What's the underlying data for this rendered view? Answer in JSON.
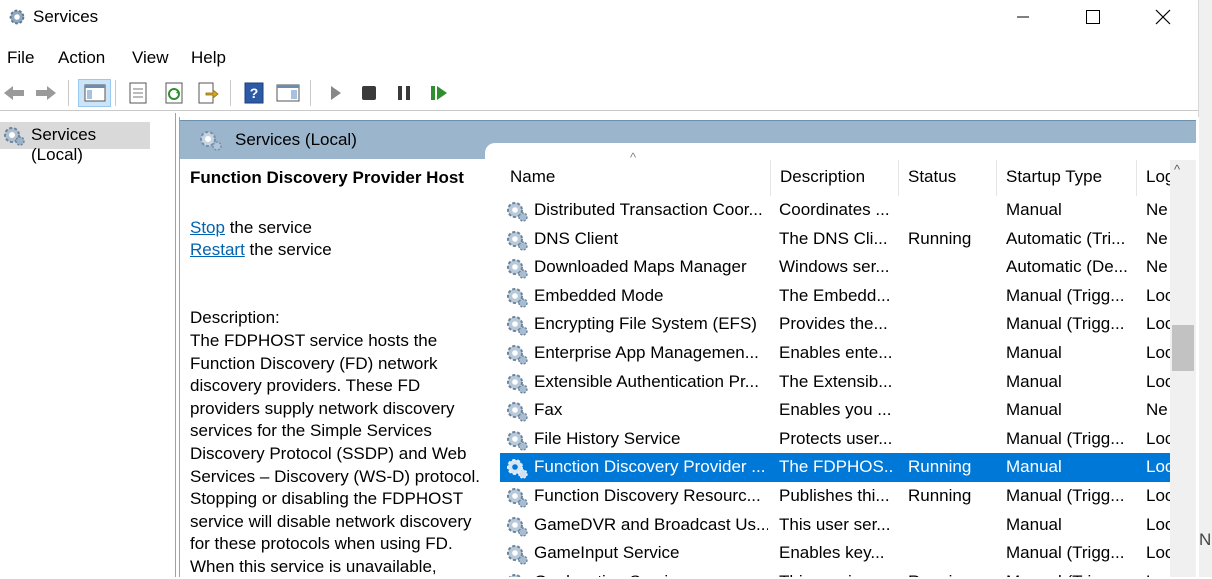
{
  "window": {
    "title": "Services",
    "app_icon": "services-gear-icon",
    "buttons": {
      "minimize": "─",
      "maximize": "☐",
      "close": "✕"
    }
  },
  "menu": [
    "File",
    "Action",
    "View",
    "Help"
  ],
  "toolbar": [
    "back-arrow-icon",
    "forward-arrow-icon",
    "show-hide-console-tree-icon",
    "properties-icon",
    "refresh-icon",
    "export-list-icon",
    "help-icon",
    "show-hide-action-pane-icon",
    "start-service-icon",
    "stop-service-icon",
    "pause-service-icon",
    "resume-service-icon"
  ],
  "tree": {
    "label": "Services (Local)"
  },
  "panel": {
    "title": "Services (Local)"
  },
  "description_pane": {
    "service_name": "Function Discovery Provider Host",
    "stop_link": "Stop",
    "stop_suffix": " the service",
    "restart_link": "Restart",
    "restart_suffix": " the service",
    "description_label": "Description:",
    "description_lines": [
      "The FDPHOST service hosts the",
      "Function Discovery (FD) network",
      "discovery providers. These FD",
      "providers supply network discovery",
      "services for the Simple Services",
      "Discovery Protocol (SSDP) and Web",
      "Services – Discovery (WS-D) protocol.",
      "Stopping or disabling the FDPHOST",
      "service will disable network discovery",
      "for these protocols when using FD.",
      "When this service is unavailable,"
    ]
  },
  "list": {
    "columns": [
      "Name",
      "Description",
      "Status",
      "Startup Type",
      "Log"
    ],
    "sort_indicator": "^",
    "rows": [
      {
        "name": "Distributed Transaction Coor...",
        "description": "Coordinates ...",
        "status": "",
        "startup": "Manual",
        "logon": "Ne"
      },
      {
        "name": "DNS Client",
        "description": "The DNS Cli...",
        "status": "Running",
        "startup": "Automatic (Tri...",
        "logon": "Ne"
      },
      {
        "name": "Downloaded Maps Manager",
        "description": "Windows ser...",
        "status": "",
        "startup": "Automatic (De...",
        "logon": "Ne"
      },
      {
        "name": "Embedded Mode",
        "description": "The Embedd...",
        "status": "",
        "startup": "Manual (Trigg...",
        "logon": "Loc"
      },
      {
        "name": "Encrypting File System (EFS)",
        "description": "Provides the...",
        "status": "",
        "startup": "Manual (Trigg...",
        "logon": "Loc"
      },
      {
        "name": "Enterprise App Managemen...",
        "description": "Enables ente...",
        "status": "",
        "startup": "Manual",
        "logon": "Loc"
      },
      {
        "name": "Extensible Authentication Pr...",
        "description": "The Extensib...",
        "status": "",
        "startup": "Manual",
        "logon": "Loc"
      },
      {
        "name": "Fax",
        "description": "Enables you ...",
        "status": "",
        "startup": "Manual",
        "logon": "Ne"
      },
      {
        "name": "File History Service",
        "description": "Protects user...",
        "status": "",
        "startup": "Manual (Trigg...",
        "logon": "Loc"
      },
      {
        "name": "Function Discovery Provider ...",
        "description": "The FDPHOS...",
        "status": "Running",
        "startup": "Manual",
        "logon": "Loc",
        "selected": true
      },
      {
        "name": "Function Discovery Resourc...",
        "description": "Publishes thi...",
        "status": "Running",
        "startup": "Manual (Trigg...",
        "logon": "Loc"
      },
      {
        "name": "GameDVR and Broadcast Us...",
        "description": "This user ser...",
        "status": "",
        "startup": "Manual",
        "logon": "Loc"
      },
      {
        "name": "GameInput Service",
        "description": "Enables key...",
        "status": "",
        "startup": "Manual (Trigg...",
        "logon": "Loc"
      },
      {
        "name": "Geolocation Service",
        "description": "This service ...",
        "status": "Running",
        "startup": "Manual (Trigg...",
        "logon": "Loc"
      }
    ]
  },
  "scrollbar": {
    "up_arrow": "^",
    "position": 0.38
  },
  "right_edge_letter": "N"
}
